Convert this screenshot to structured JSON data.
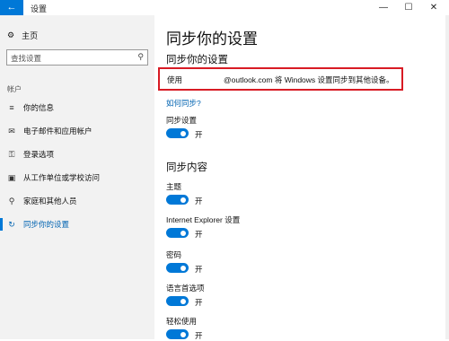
{
  "window": {
    "title": "设置",
    "back_glyph": "←",
    "min_glyph": "—",
    "max_glyph": "☐",
    "close_glyph": "✕"
  },
  "sidebar": {
    "home_label": "主页",
    "search_placeholder": "查找设置",
    "section_label": "帐户",
    "items": [
      {
        "label": "你的信息",
        "icon": "contact-card-icon",
        "glyph": "≡"
      },
      {
        "label": "电子邮件和应用帐户",
        "icon": "mail-icon",
        "glyph": "✉"
      },
      {
        "label": "登录选项",
        "icon": "key-icon",
        "glyph": "⚿"
      },
      {
        "label": "从工作单位或学校访问",
        "icon": "briefcase-icon",
        "glyph": "▣"
      },
      {
        "label": "家庭和其他人员",
        "icon": "person-icon",
        "glyph": "⚲"
      },
      {
        "label": "同步你的设置",
        "icon": "sync-icon",
        "glyph": "↻",
        "active": true
      }
    ]
  },
  "main": {
    "page_title": "同步你的设置",
    "section1_title": "同步你的设置",
    "sync_prefix": "使用",
    "sync_suffix": "@outlook.com 将 Windows 设置同步到其他设备。",
    "how_link": "如何同步?",
    "master_label": "同步设置",
    "master_state": "开",
    "section2_title": "同步内容",
    "toggles": [
      {
        "label": "主题",
        "state": "开"
      },
      {
        "label": "Internet Explorer 设置",
        "state": "开"
      },
      {
        "label": "密码",
        "state": "开"
      },
      {
        "label": "语言首选项",
        "state": "开"
      },
      {
        "label": "轻松使用",
        "state": "开"
      }
    ]
  },
  "colors": {
    "accent": "#0078d7",
    "highlight_box": "#d81b24",
    "sidebar_bg": "#f2f2f2"
  }
}
